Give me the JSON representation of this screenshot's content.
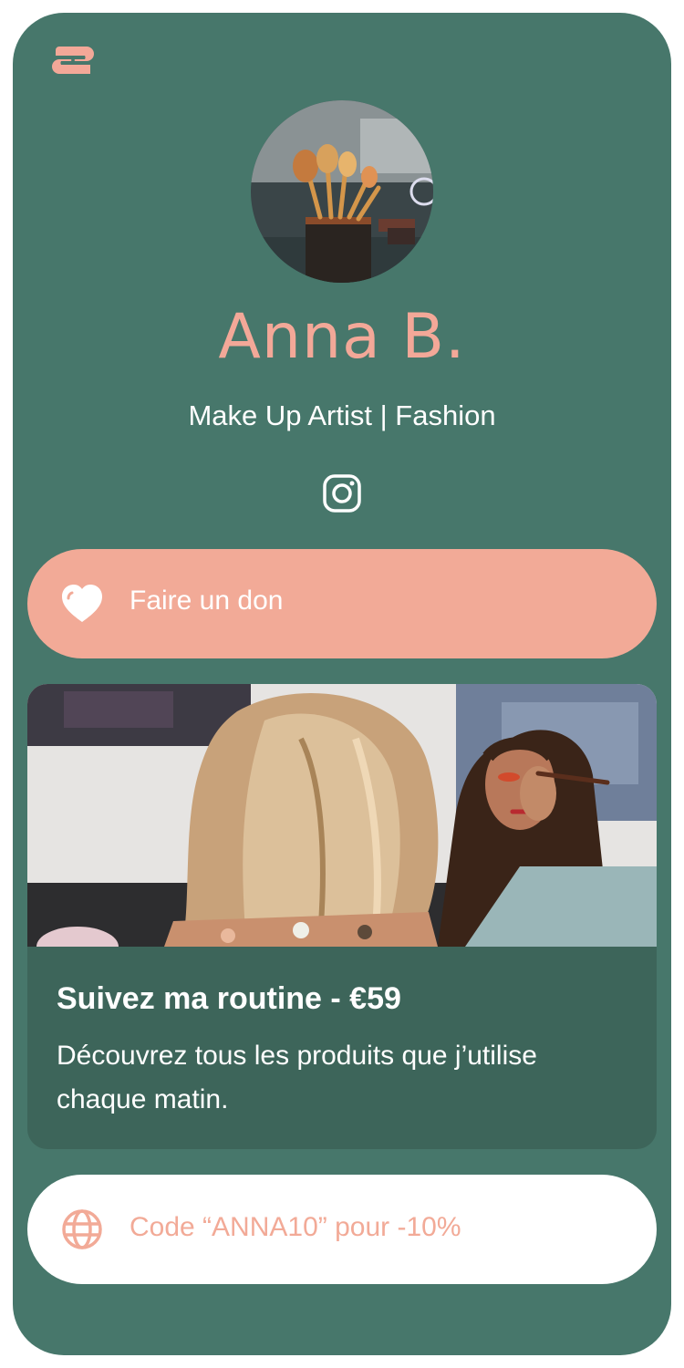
{
  "colors": {
    "background": "#47776b",
    "accent": "#f3a898",
    "product_card": "#3d655a",
    "white": "#ffffff"
  },
  "brand": {
    "logo_icon": "s-logo-icon"
  },
  "profile": {
    "name": "Anna B.",
    "bio": "Make Up Artist | Fashion",
    "avatar_icon": "makeup-brushes-photo",
    "social_icon": "instagram-icon"
  },
  "donate": {
    "label": "Faire un don",
    "icon": "heart-icon"
  },
  "product": {
    "title": "Suivez ma routine - €59",
    "description": "Découvrez tous les produits que j’utilise chaque matin.",
    "image": "makeup-application-photo"
  },
  "promo": {
    "label": "Code “ANNA10” pour -10%",
    "icon": "globe-icon"
  }
}
